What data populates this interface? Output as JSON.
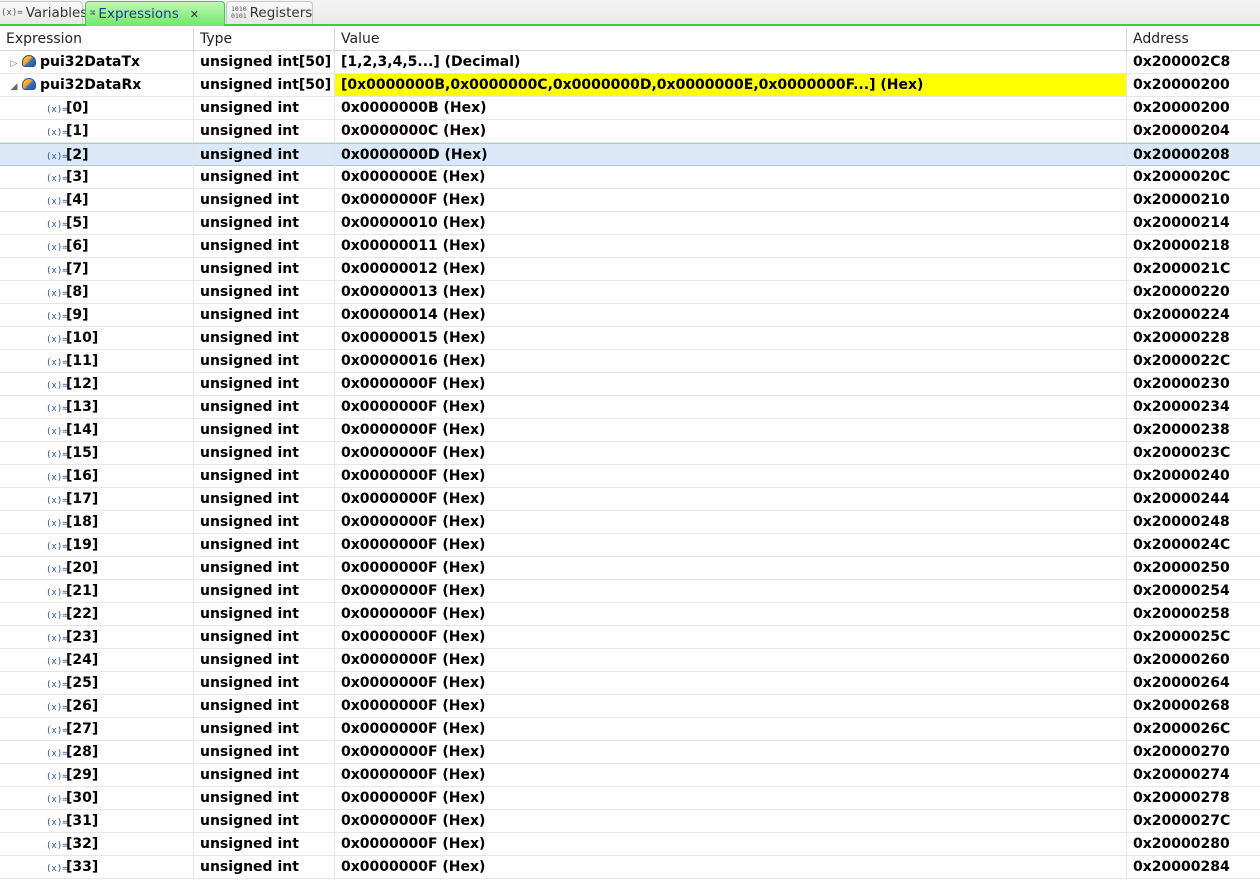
{
  "tabs": [
    {
      "label": "Variables",
      "icon": "(x)="
    },
    {
      "label": "Expressions",
      "icon": "expressions-icon",
      "active": true
    },
    {
      "label": "Registers",
      "icon": "1010 0101"
    }
  ],
  "columns": {
    "expression": "Expression",
    "type": "Type",
    "value": "Value",
    "address": "Address"
  },
  "root_rows": [
    {
      "expression": "pui32DataTx",
      "type": "unsigned int[50]",
      "value": "[1,2,3,4,5...] (Decimal)",
      "address": "0x200002C8",
      "expanded": false
    },
    {
      "expression": "pui32DataRx",
      "type": "unsigned int[50]",
      "value": "[0x0000000B,0x0000000C,0x0000000D,0x0000000E,0x0000000F...] (Hex)",
      "address": "0x20000200",
      "expanded": true,
      "highlight_color": "#ffff00"
    }
  ],
  "child_rows": [
    {
      "expression": "[0]",
      "type": "unsigned int",
      "value": "0x0000000B (Hex)",
      "address": "0x20000200"
    },
    {
      "expression": "[1]",
      "type": "unsigned int",
      "value": "0x0000000C (Hex)",
      "address": "0x20000204"
    },
    {
      "expression": "[2]",
      "type": "unsigned int",
      "value": "0x0000000D (Hex)",
      "address": "0x20000208",
      "selected": true
    },
    {
      "expression": "[3]",
      "type": "unsigned int",
      "value": "0x0000000E (Hex)",
      "address": "0x2000020C"
    },
    {
      "expression": "[4]",
      "type": "unsigned int",
      "value": "0x0000000F (Hex)",
      "address": "0x20000210"
    },
    {
      "expression": "[5]",
      "type": "unsigned int",
      "value": "0x00000010 (Hex)",
      "address": "0x20000214"
    },
    {
      "expression": "[6]",
      "type": "unsigned int",
      "value": "0x00000011 (Hex)",
      "address": "0x20000218"
    },
    {
      "expression": "[7]",
      "type": "unsigned int",
      "value": "0x00000012 (Hex)",
      "address": "0x2000021C"
    },
    {
      "expression": "[8]",
      "type": "unsigned int",
      "value": "0x00000013 (Hex)",
      "address": "0x20000220"
    },
    {
      "expression": "[9]",
      "type": "unsigned int",
      "value": "0x00000014 (Hex)",
      "address": "0x20000224"
    },
    {
      "expression": "[10]",
      "type": "unsigned int",
      "value": "0x00000015 (Hex)",
      "address": "0x20000228"
    },
    {
      "expression": "[11]",
      "type": "unsigned int",
      "value": "0x00000016 (Hex)",
      "address": "0x2000022C"
    },
    {
      "expression": "[12]",
      "type": "unsigned int",
      "value": "0x0000000F (Hex)",
      "address": "0x20000230"
    },
    {
      "expression": "[13]",
      "type": "unsigned int",
      "value": "0x0000000F (Hex)",
      "address": "0x20000234"
    },
    {
      "expression": "[14]",
      "type": "unsigned int",
      "value": "0x0000000F (Hex)",
      "address": "0x20000238"
    },
    {
      "expression": "[15]",
      "type": "unsigned int",
      "value": "0x0000000F (Hex)",
      "address": "0x2000023C"
    },
    {
      "expression": "[16]",
      "type": "unsigned int",
      "value": "0x0000000F (Hex)",
      "address": "0x20000240"
    },
    {
      "expression": "[17]",
      "type": "unsigned int",
      "value": "0x0000000F (Hex)",
      "address": "0x20000244"
    },
    {
      "expression": "[18]",
      "type": "unsigned int",
      "value": "0x0000000F (Hex)",
      "address": "0x20000248"
    },
    {
      "expression": "[19]",
      "type": "unsigned int",
      "value": "0x0000000F (Hex)",
      "address": "0x2000024C"
    },
    {
      "expression": "[20]",
      "type": "unsigned int",
      "value": "0x0000000F (Hex)",
      "address": "0x20000250"
    },
    {
      "expression": "[21]",
      "type": "unsigned int",
      "value": "0x0000000F (Hex)",
      "address": "0x20000254"
    },
    {
      "expression": "[22]",
      "type": "unsigned int",
      "value": "0x0000000F (Hex)",
      "address": "0x20000258"
    },
    {
      "expression": "[23]",
      "type": "unsigned int",
      "value": "0x0000000F (Hex)",
      "address": "0x2000025C"
    },
    {
      "expression": "[24]",
      "type": "unsigned int",
      "value": "0x0000000F (Hex)",
      "address": "0x20000260"
    },
    {
      "expression": "[25]",
      "type": "unsigned int",
      "value": "0x0000000F (Hex)",
      "address": "0x20000264"
    },
    {
      "expression": "[26]",
      "type": "unsigned int",
      "value": "0x0000000F (Hex)",
      "address": "0x20000268"
    },
    {
      "expression": "[27]",
      "type": "unsigned int",
      "value": "0x0000000F (Hex)",
      "address": "0x2000026C"
    },
    {
      "expression": "[28]",
      "type": "unsigned int",
      "value": "0x0000000F (Hex)",
      "address": "0x20000270"
    },
    {
      "expression": "[29]",
      "type": "unsigned int",
      "value": "0x0000000F (Hex)",
      "address": "0x20000274"
    },
    {
      "expression": "[30]",
      "type": "unsigned int",
      "value": "0x0000000F (Hex)",
      "address": "0x20000278"
    },
    {
      "expression": "[31]",
      "type": "unsigned int",
      "value": "0x0000000F (Hex)",
      "address": "0x2000027C"
    },
    {
      "expression": "[32]",
      "type": "unsigned int",
      "value": "0x0000000F (Hex)",
      "address": "0x20000280"
    },
    {
      "expression": "[33]",
      "type": "unsigned int",
      "value": "0x0000000F (Hex)",
      "address": "0x20000284"
    }
  ]
}
